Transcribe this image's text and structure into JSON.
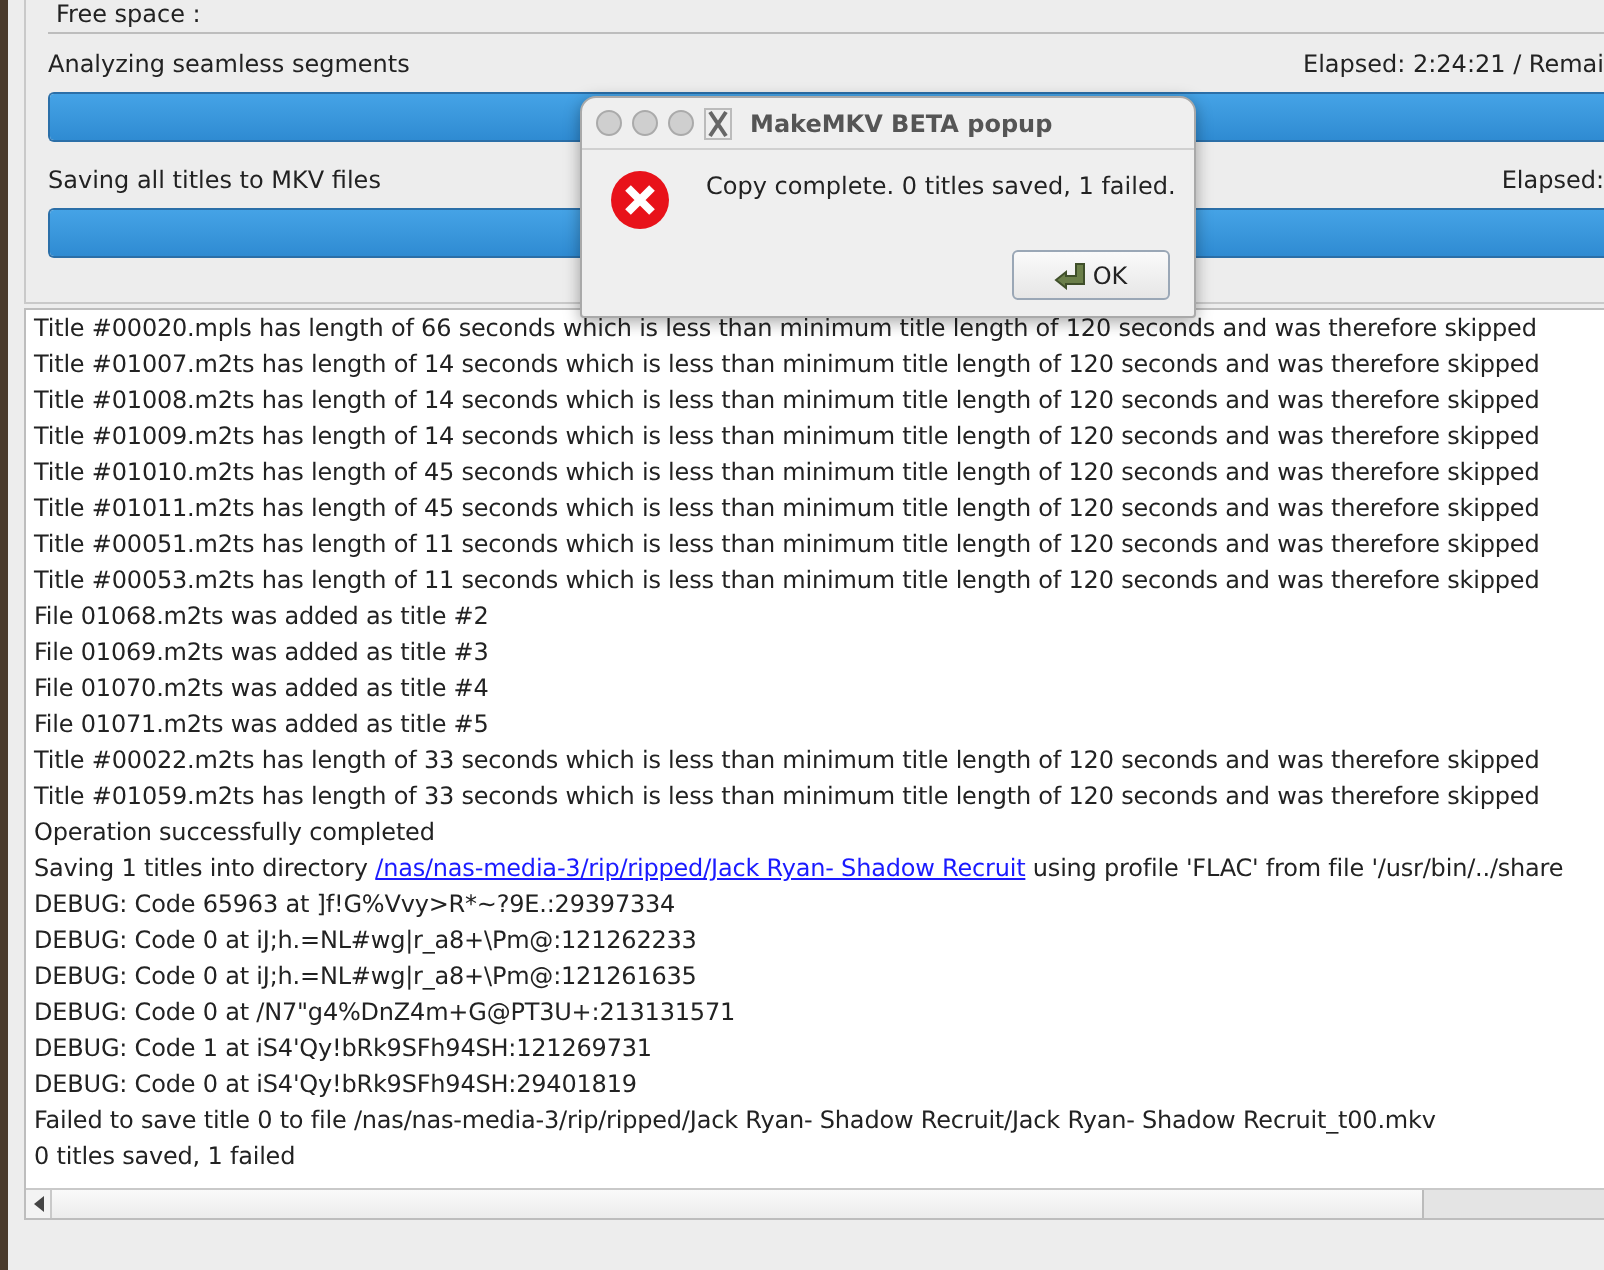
{
  "main": {
    "free_space_label": "Free space :",
    "tasks": [
      {
        "label": "Analyzing seamless segments",
        "elapsed": "Elapsed: 2:24:21 / Remai",
        "level": 1
      },
      {
        "label": "Saving all titles to MKV files",
        "elapsed": "Elapsed:",
        "level": 1
      }
    ],
    "log": [
      {
        "kind": "text",
        "text": "Title #00020.mpls has length of 66 seconds which is less than minimum title length of 120 seconds and was therefore skipped"
      },
      {
        "kind": "text",
        "text": "Title #01007.m2ts has length of 14 seconds which is less than minimum title length of 120 seconds and was therefore skipped"
      },
      {
        "kind": "text",
        "text": "Title #01008.m2ts has length of 14 seconds which is less than minimum title length of 120 seconds and was therefore skipped"
      },
      {
        "kind": "text",
        "text": "Title #01009.m2ts has length of 14 seconds which is less than minimum title length of 120 seconds and was therefore skipped"
      },
      {
        "kind": "text",
        "text": "Title #01010.m2ts has length of 45 seconds which is less than minimum title length of 120 seconds and was therefore skipped"
      },
      {
        "kind": "text",
        "text": "Title #01011.m2ts has length of 45 seconds which is less than minimum title length of 120 seconds and was therefore skipped"
      },
      {
        "kind": "text",
        "text": "Title #00051.m2ts has length of 11 seconds which is less than minimum title length of 120 seconds and was therefore skipped"
      },
      {
        "kind": "text",
        "text": "Title #00053.m2ts has length of 11 seconds which is less than minimum title length of 120 seconds and was therefore skipped"
      },
      {
        "kind": "text",
        "text": "File 01068.m2ts was added as title #2"
      },
      {
        "kind": "text",
        "text": "File 01069.m2ts was added as title #3"
      },
      {
        "kind": "text",
        "text": "File 01070.m2ts was added as title #4"
      },
      {
        "kind": "text",
        "text": "File 01071.m2ts was added as title #5"
      },
      {
        "kind": "text",
        "text": "Title #00022.m2ts has length of 33 seconds which is less than minimum title length of 120 seconds and was therefore skipped"
      },
      {
        "kind": "text",
        "text": "Title #01059.m2ts has length of 33 seconds which is less than minimum title length of 120 seconds and was therefore skipped"
      },
      {
        "kind": "text",
        "text": "Operation successfully completed"
      },
      {
        "kind": "link",
        "before": "Saving 1 titles into directory",
        "link": "/nas/nas-media-3/rip/ripped/Jack Ryan- Shadow Recruit",
        "after": "using profile 'FLAC' from file '/usr/bin/../share"
      },
      {
        "kind": "text",
        "text": "DEBUG: Code 65963 at ]f!G%Vvy>R*~?9E.:29397334"
      },
      {
        "kind": "text",
        "text": "DEBUG: Code 0 at iJ;h.=NL#wg|r_a8+\\Pm@:121262233"
      },
      {
        "kind": "text",
        "text": "DEBUG: Code 0 at iJ;h.=NL#wg|r_a8+\\Pm@:121261635"
      },
      {
        "kind": "text",
        "text": "DEBUG: Code 0 at /N7\"g4%DnZ4m+G@PT3U+:213131571"
      },
      {
        "kind": "text",
        "text": "DEBUG: Code 1 at iS4'Qy!bRk9SFh94SH:121269731"
      },
      {
        "kind": "text",
        "text": "DEBUG: Code 0 at iS4'Qy!bRk9SFh94SH:29401819"
      },
      {
        "kind": "text",
        "text": "Failed to save title 0 to file /nas/nas-media-3/rip/ripped/Jack Ryan- Shadow Recruit/Jack Ryan- Shadow Recruit_t00.mkv"
      },
      {
        "kind": "text",
        "text": "0 titles saved, 1 failed"
      }
    ]
  },
  "popup": {
    "title": "MakeMKV BETA popup",
    "message": "Copy complete. 0 titles saved, 1 failed.",
    "button": "OK"
  }
}
